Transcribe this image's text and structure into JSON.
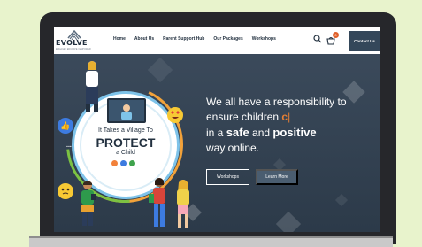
{
  "header": {
    "logo_text": "EVOLVE",
    "logo_tagline": "ENGAGE | EDUCATE | EMPOWER",
    "nav": [
      "Home",
      "About Us",
      "Parent Support Hub",
      "Our Packages",
      "Workshops"
    ],
    "cart_count": "0",
    "contact_label": "Contact Us"
  },
  "hero": {
    "line1": "We all have a responsibility to",
    "line2_prefix": "ensure children ",
    "line2_typed": "c",
    "line3_prefix": "in a ",
    "line3_safe": "safe",
    "line3_and": " and ",
    "line3_positive": "positive",
    "line4": "way online.",
    "btn_workshops": "Workshops",
    "btn_learn": "Learn More"
  },
  "illustration": {
    "title": "It Takes a Village To",
    "protect": "PROTECT",
    "child": "a Child",
    "bubble_dots": "..."
  },
  "colors": {
    "accent_orange": "#e87f33",
    "hero_bg": "#3b4a5b",
    "contact_btn": "#34475a",
    "dot_orange": "#f2813a",
    "dot_blue": "#3d7be0",
    "dot_green": "#3fa34d"
  },
  "icons": {
    "search": "search-icon",
    "cart": "cart-icon",
    "like": "thumbs-up-icon"
  }
}
